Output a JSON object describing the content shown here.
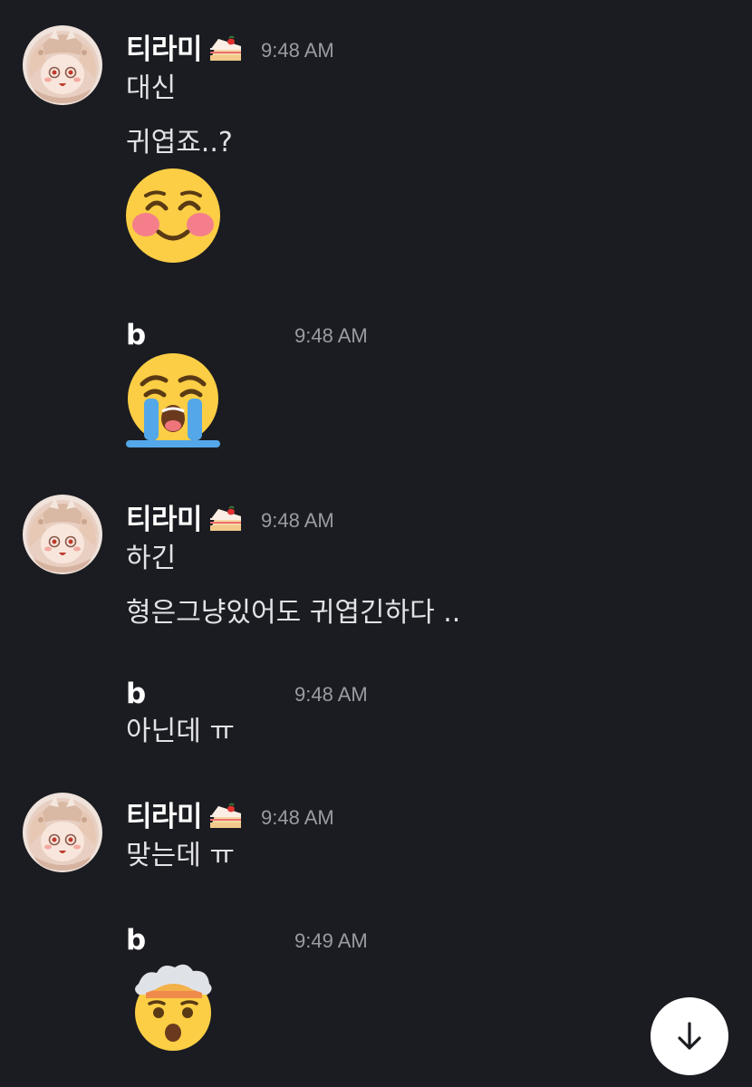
{
  "messages": [
    {
      "author": "티라미",
      "time": "9:48 AM",
      "lines": [
        "대신",
        "귀엽죠..?"
      ],
      "emoji": "smiling-face-with-smiling-eyes-emoji"
    },
    {
      "author": "b",
      "time": "9:48 AM",
      "emoji": "loudly-crying-face-emoji"
    },
    {
      "author": "티라미",
      "time": "9:48 AM",
      "lines": [
        "하긴",
        "형은그냥있어도 귀엽긴하다 .."
      ]
    },
    {
      "author": "b",
      "time": "9:48 AM",
      "lines": [
        "아닌데 ㅠ"
      ]
    },
    {
      "author": "티라미",
      "time": "9:48 AM",
      "lines": [
        "맞는데 ㅠ"
      ]
    },
    {
      "author": "b",
      "time": "9:49 AM",
      "emoji": "exploding-head-emoji"
    }
  ],
  "icons": {
    "author_badge": "shortcake-icon",
    "scroll_button": "arrow-down-icon"
  },
  "colors": {
    "background": "#1b1c21",
    "username": "#ffffff",
    "timestamp": "#9a9ba3",
    "message_text": "#e2e3e7"
  }
}
